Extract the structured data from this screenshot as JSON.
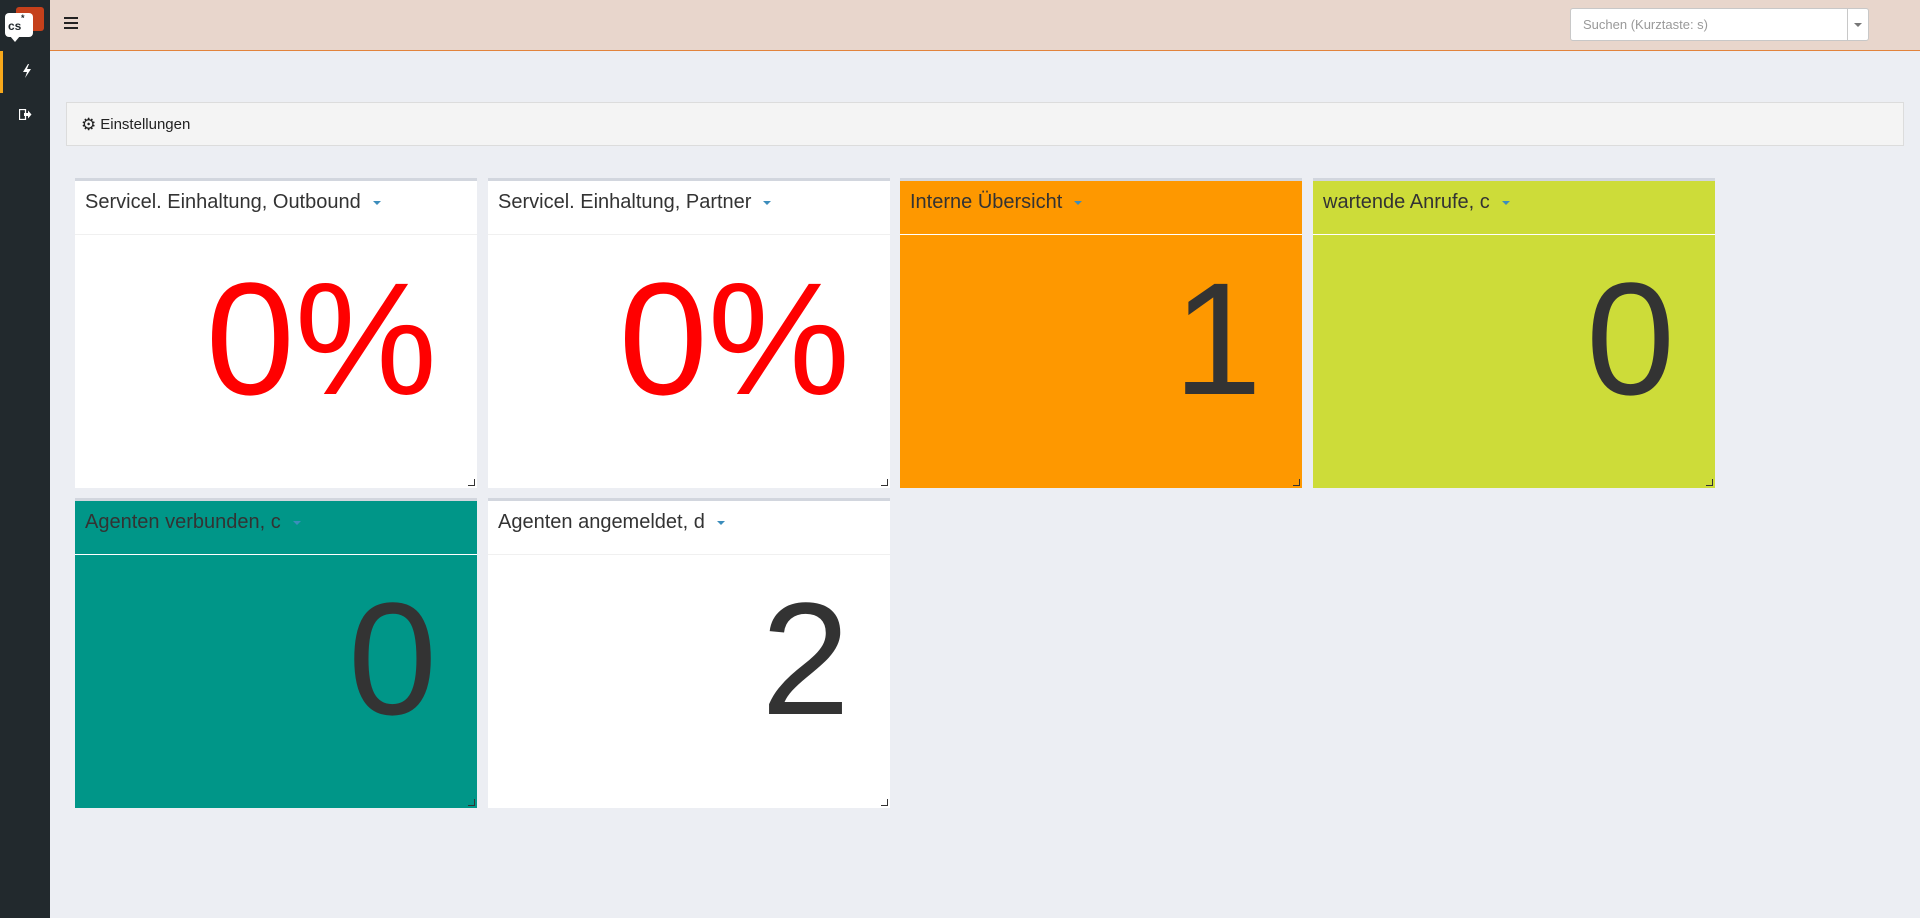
{
  "app": {
    "logo_text": "cs",
    "logo_star": "*"
  },
  "sidebar": {
    "items": [
      {
        "icon": "bolt-icon",
        "glyph": "⚡"
      },
      {
        "icon": "sign-out-icon",
        "glyph": "⇥"
      }
    ]
  },
  "topbar": {
    "search_placeholder": "Suchen (Kurztaste: s)"
  },
  "settings": {
    "label": "Einstellungen"
  },
  "colors": {
    "orange": "#fe9800",
    "lime": "#cddc39",
    "teal": "#009688",
    "red": "#ff0000"
  },
  "widgets": [
    {
      "title": "Servicel. Einhaltung, Outbound",
      "value": "0%"
    },
    {
      "title": "Servicel. Einhaltung, Partner",
      "value": "0%"
    },
    {
      "title": "Interne Übersicht",
      "value": "1"
    },
    {
      "title": "wartende Anrufe, c",
      "value": "0"
    },
    {
      "title": "Agenten verbunden, c",
      "value": "0"
    },
    {
      "title": "Agenten angemeldet, d",
      "value": "2"
    }
  ]
}
